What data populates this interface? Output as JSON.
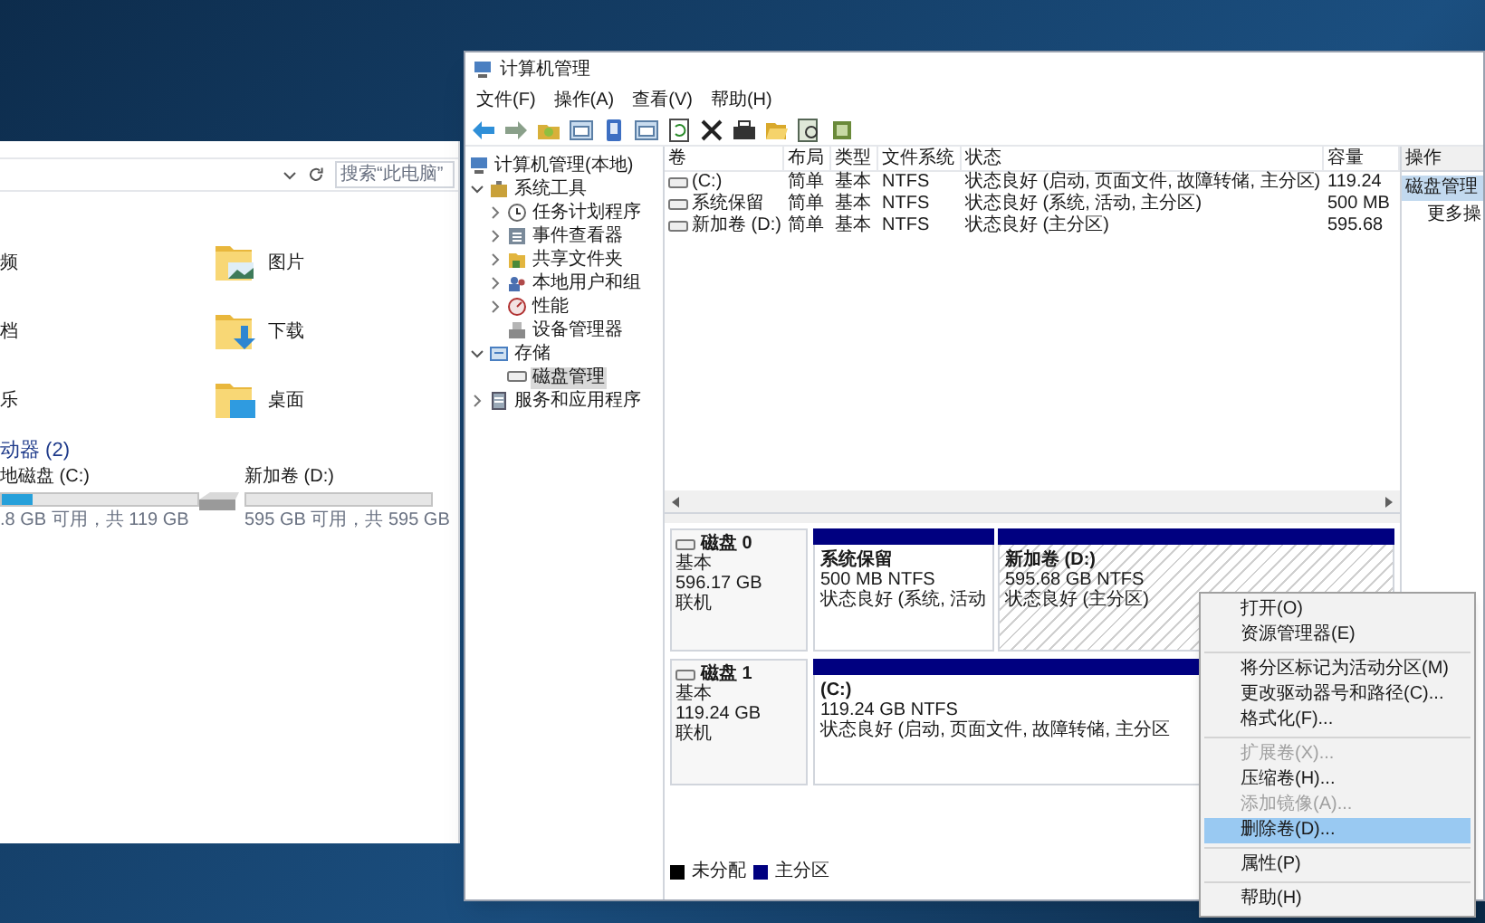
{
  "explorer": {
    "search": {
      "placeholder": "搜索“此电脑”"
    },
    "left_items": [
      "频",
      "档",
      "乐"
    ],
    "folders": [
      "图片",
      "下载",
      "桌面"
    ],
    "drives_heading": "动器 (2)",
    "drives": [
      {
        "name": "地磁盘 (C:)",
        "level": 0.16,
        "free": ".8 GB 可用，共 119 GB"
      },
      {
        "name": "新加卷 (D:)",
        "level": 0,
        "free": "595 GB 可用，共 595 GB"
      }
    ]
  },
  "mgmt": {
    "window": {
      "title": "计算机管理"
    },
    "menu": [
      "文件(F)",
      "操作(A)",
      "查看(V)",
      "帮助(H)"
    ],
    "tree": [
      {
        "label": "计算机管理(本地)",
        "selected": false,
        "children": [
          {
            "label": "系统工具",
            "expanded": true,
            "selected": false,
            "children": [
              {
                "label": "任务计划程序",
                "expanded": false,
                "selected": false
              },
              {
                "label": "事件查看器",
                "expanded": false,
                "selected": false
              },
              {
                "label": "共享文件夹",
                "expanded": false,
                "selected": false
              },
              {
                "label": "本地用户和组",
                "expanded": false,
                "selected": false
              },
              {
                "label": "性能",
                "expanded": false,
                "selected": false
              },
              {
                "label": "设备管理器",
                "selected": false
              }
            ]
          },
          {
            "label": "存储",
            "expanded": true,
            "selected": false,
            "children": [
              {
                "label": "磁盘管理",
                "selected": true
              }
            ]
          },
          {
            "label": "服务和应用程序",
            "expanded": false,
            "selected": false
          }
        ]
      }
    ],
    "volumes": {
      "columns": [
        "卷",
        "布局",
        "类型",
        "文件系统",
        "状态",
        "容量"
      ],
      "rows": [
        [
          "(C:)",
          "简单",
          "基本",
          "NTFS",
          "状态良好 (启动, 页面文件, 故障转储, 主分区)",
          "119.24"
        ],
        [
          "系统保留",
          "简单",
          "基本",
          "NTFS",
          "状态良好 (系统, 活动, 主分区)",
          "500 MB"
        ],
        [
          "新加卷 (D:)",
          "简单",
          "基本",
          "NTFS",
          "状态良好 (主分区)",
          "595.68"
        ]
      ]
    },
    "disks": [
      {
        "name": "磁盘 0",
        "type": "基本",
        "size": "596.17 GB",
        "status": "联机",
        "partitions": [
          {
            "name": "系统保留",
            "size": "500 MB NTFS",
            "status": "状态良好 (系统, 活动",
            "selected": false
          },
          {
            "name": "新加卷  (D:)",
            "size": "595.68 GB NTFS",
            "status": "状态良好 (主分区)",
            "selected": true
          }
        ]
      },
      {
        "name": "磁盘 1",
        "type": "基本",
        "size": "119.24 GB",
        "status": "联机",
        "partitions": [
          {
            "name": "(C:)",
            "size": "119.24 GB NTFS",
            "status": "状态良好 (启动, 页面文件, 故障转储, 主分区",
            "selected": false
          }
        ]
      }
    ],
    "legend": [
      {
        "label": "未分配",
        "color": "#000000"
      },
      {
        "label": "主分区",
        "color": "#000080"
      }
    ],
    "actions": {
      "title": "操作",
      "items": [
        {
          "label": "磁盘管理",
          "kind": "section"
        },
        {
          "label": "更多操",
          "kind": "link"
        }
      ]
    },
    "context_menu": [
      {
        "kind": "item",
        "label": "打开(O)",
        "disabled": false,
        "selected": false
      },
      {
        "kind": "item",
        "label": "资源管理器(E)",
        "disabled": false,
        "selected": false
      },
      {
        "kind": "separator"
      },
      {
        "kind": "item",
        "label": "将分区标记为活动分区(M)",
        "disabled": false,
        "selected": false
      },
      {
        "kind": "item",
        "label": "更改驱动器号和路径(C)...",
        "disabled": false,
        "selected": false
      },
      {
        "kind": "item",
        "label": "格式化(F)...",
        "disabled": false,
        "selected": false
      },
      {
        "kind": "separator"
      },
      {
        "kind": "item",
        "label": "扩展卷(X)...",
        "disabled": true,
        "selected": false
      },
      {
        "kind": "item",
        "label": "压缩卷(H)...",
        "disabled": false,
        "selected": false
      },
      {
        "kind": "item",
        "label": "添加镜像(A)...",
        "disabled": true,
        "selected": false
      },
      {
        "kind": "item",
        "label": "删除卷(D)...",
        "disabled": false,
        "selected": true
      },
      {
        "kind": "separator"
      },
      {
        "kind": "item",
        "label": "属性(P)",
        "disabled": false,
        "selected": false
      },
      {
        "kind": "separator"
      },
      {
        "kind": "item",
        "label": "帮助(H)",
        "disabled": false,
        "selected": false
      }
    ]
  }
}
